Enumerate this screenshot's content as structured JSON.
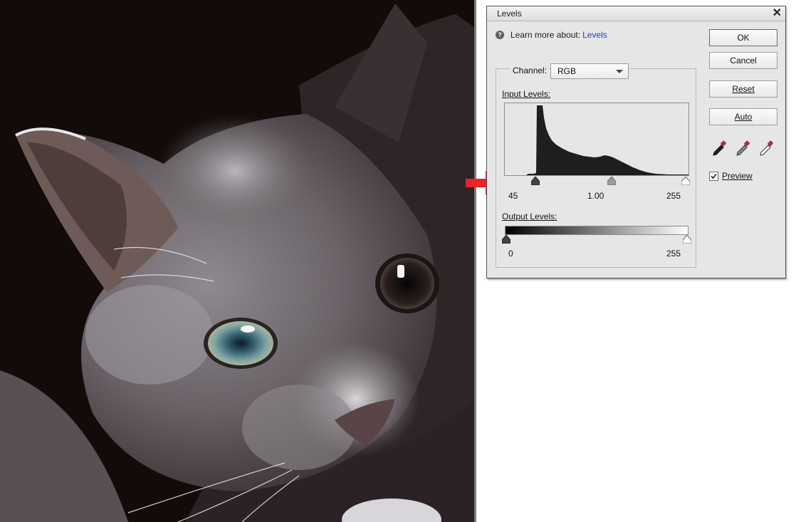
{
  "dialog": {
    "title": "Levels",
    "help_text": "Learn more about:",
    "help_link": "Levels",
    "channel_label": "Channel:",
    "channel_value": "RGB",
    "input_levels_label": "Input Levels:",
    "output_levels_label": "Output Levels:",
    "input_black": "45",
    "input_gamma": "1.00",
    "input_white": "255",
    "output_black": "0",
    "output_white": "255",
    "buttons": {
      "ok": "OK",
      "cancel": "Cancel",
      "reset": "Reset",
      "auto": "Auto"
    },
    "preview_label": "Preview",
    "preview_checked": true
  },
  "icons": {
    "close": "close-icon",
    "help": "help-icon",
    "eyedroppers": [
      "black-eyedropper-icon",
      "gray-eyedropper-icon",
      "white-eyedropper-icon"
    ],
    "annotation": "red-arrow-icon"
  },
  "colors": {
    "dialog_bg": "#e6e6e6",
    "link": "#1a3fd0",
    "arrow": "#ee2222"
  }
}
